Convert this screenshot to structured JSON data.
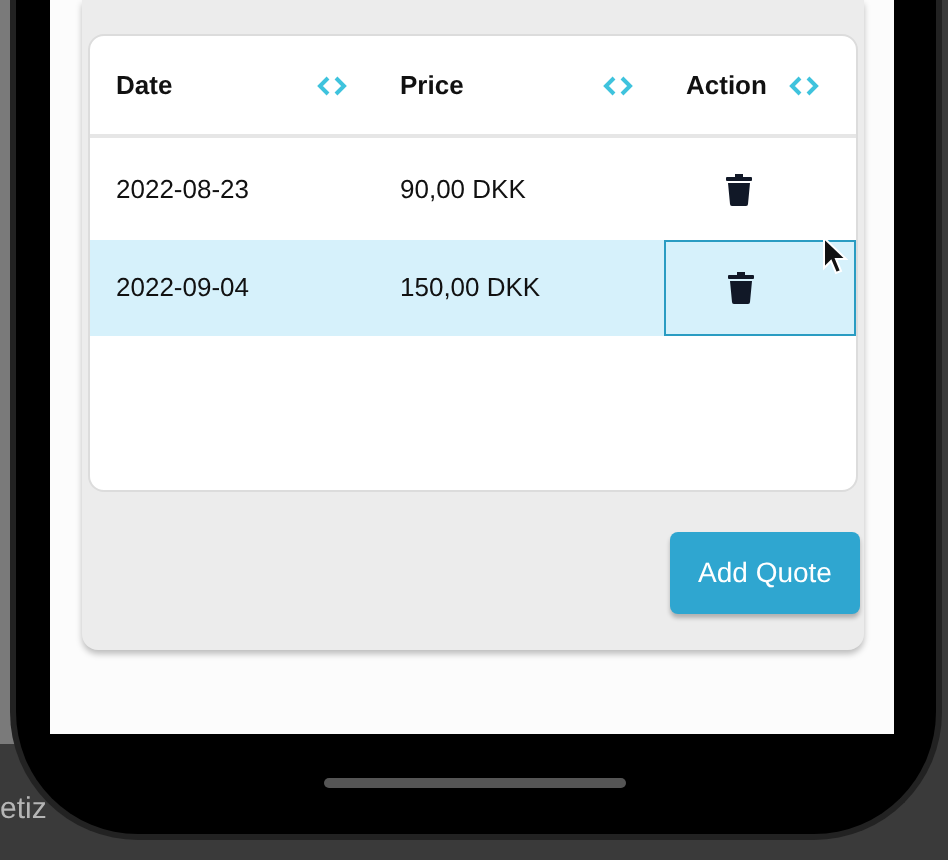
{
  "background_text": "etiz",
  "table": {
    "columns": [
      {
        "label": "Date",
        "sortable": true
      },
      {
        "label": "Price",
        "sortable": true
      },
      {
        "label": "Action",
        "sortable": true
      }
    ],
    "rows": [
      {
        "date": "2022-08-23",
        "price": "90,00 DKK",
        "selected": false,
        "action_focused": false
      },
      {
        "date": "2022-09-04",
        "price": "150,00 DKK",
        "selected": true,
        "action_focused": true
      }
    ]
  },
  "add_button": {
    "label": "Add Quote"
  }
}
